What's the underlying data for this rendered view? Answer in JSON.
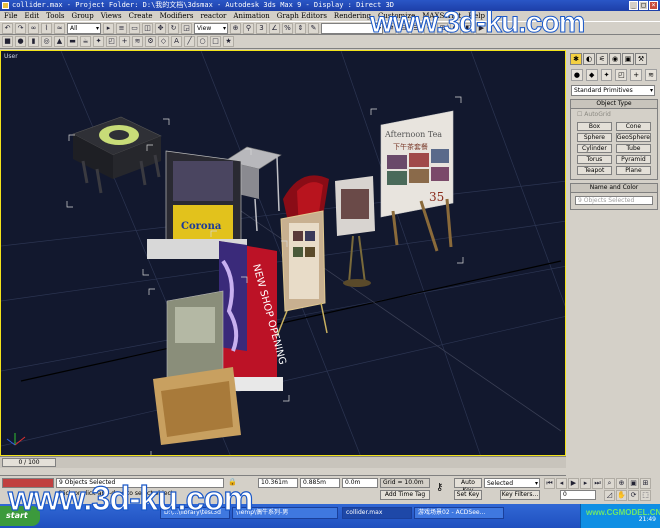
{
  "window": {
    "title": "collider.max  - Project Folder: D:\\我的文档\\3dsmax   - Autodesk 3ds Max 9   - Display : Direct 3D",
    "controls": [
      "_",
      "□",
      "×"
    ]
  },
  "menu": [
    "File",
    "Edit",
    "Tools",
    "Group",
    "Views",
    "Create",
    "Modifiers",
    "reactor",
    "Animation",
    "Graph Editors",
    "Rendering",
    "Customize",
    "MAXScript",
    "Help"
  ],
  "toolbar": {
    "selection_filter": "All",
    "reference_coord": "View",
    "selection_set": ""
  },
  "viewport": {
    "label": "User",
    "accent": "#f2e21a",
    "background": "#12182e",
    "signs": {
      "poster_title": "Afternoon Tea",
      "poster_subtitle": "下午茶套餐",
      "poster_price": "35",
      "corona": "Corona",
      "banner": "NEW SHOP OPENING"
    }
  },
  "command_panel": {
    "category": "Standard Primitives",
    "object_type_header": "Object Type",
    "autogrid": "AutoGrid",
    "primitives": [
      "Box",
      "Cone",
      "Sphere",
      "GeoSphere",
      "Cylinder",
      "Tube",
      "Torus",
      "Pyramid",
      "Teapot",
      "Plane"
    ],
    "name_color_header": "Name and Color",
    "name_value": "9 Objects Selected"
  },
  "timeline": {
    "frame": "0 / 100"
  },
  "status": {
    "selection": "9 Objects Selected",
    "prompt": "Click or click-and-drag to select objects",
    "x": "10.361m",
    "y": "0.885m",
    "z": "0.0m",
    "grid": "Grid = 10.0m",
    "add_time_tag": "Add Time Tag",
    "auto_key": "Auto Key",
    "set_key": "Set Key",
    "key_mode": "Selected",
    "key_filters": "Key Filters...",
    "frame_field": "0"
  },
  "taskbar": {
    "start": "start",
    "tasks": [
      "D:\\...\\library\\test3d",
      "\\Temp\\偶牛系列-男",
      "collider.max",
      "游戏场景02 - ACDSee..."
    ],
    "clock": "21:49"
  },
  "watermarks": {
    "top": "www.3d-ku.com",
    "bottom": "www.3d-ku.com",
    "corner": "www.CGMODEL.CN"
  }
}
